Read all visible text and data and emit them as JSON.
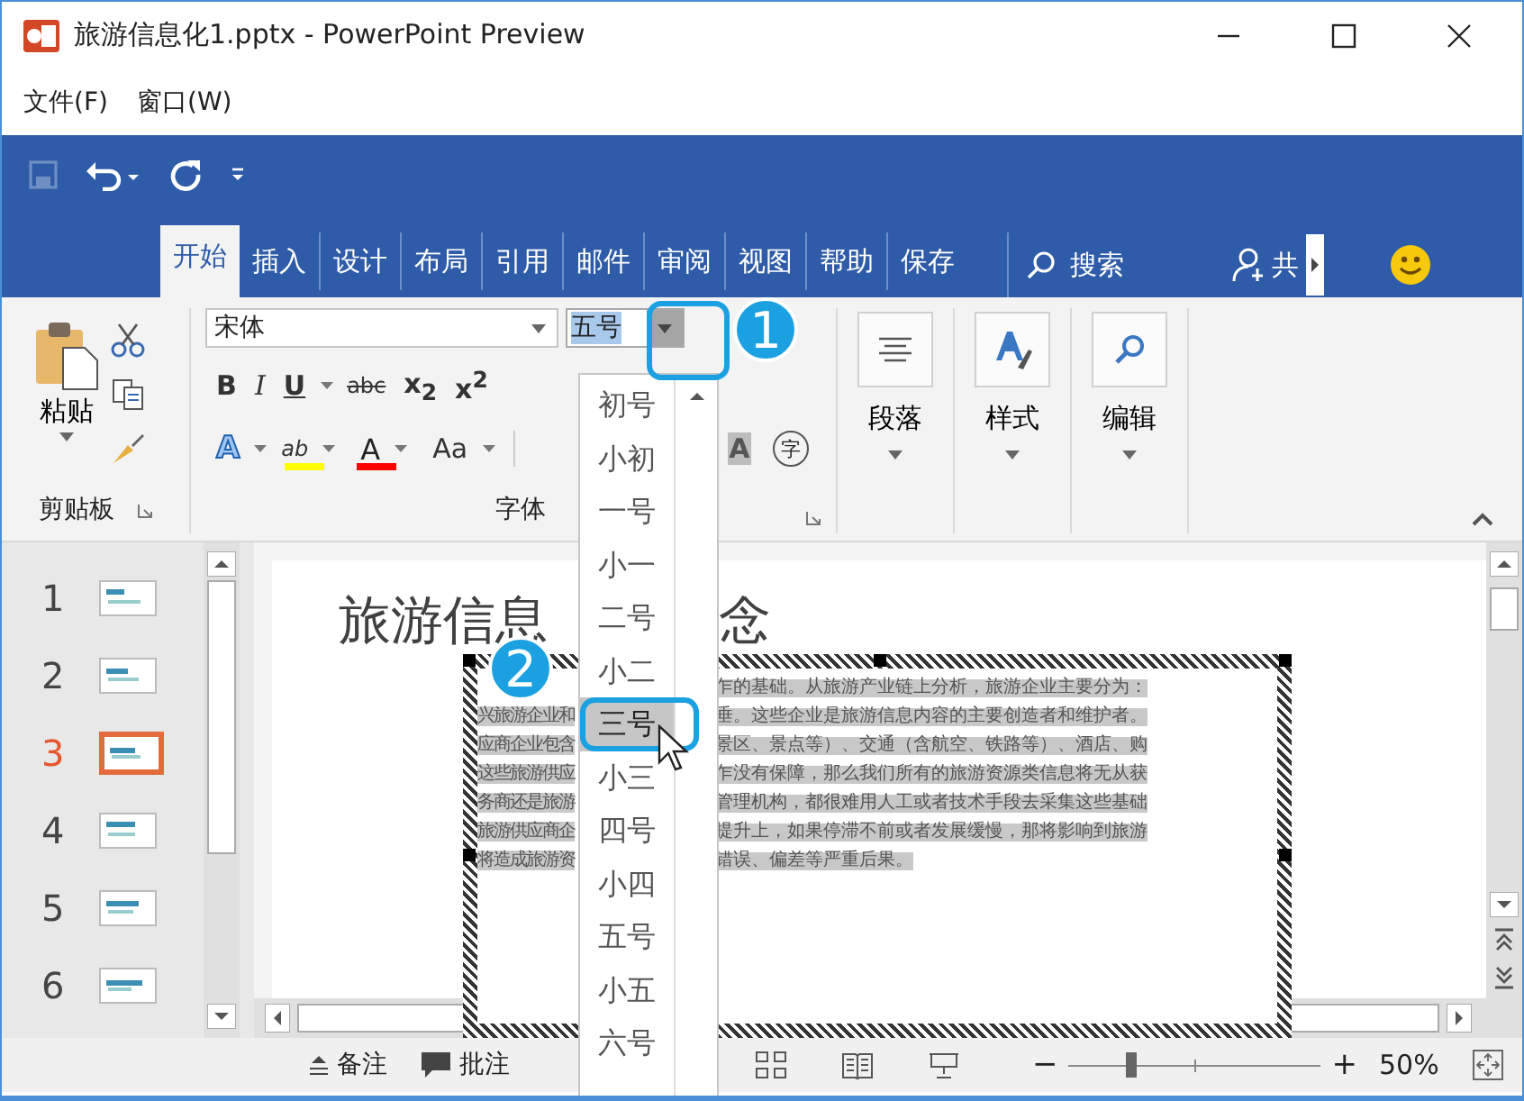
{
  "window": {
    "title": "旅游信息化1.pptx - PowerPoint Preview"
  },
  "menu": [
    "文件(F)",
    "窗口(W)"
  ],
  "quick_access": {
    "save_disabled": true
  },
  "tabs": [
    {
      "label": "开始",
      "selected": true
    },
    {
      "label": "插入",
      "selected": false
    },
    {
      "label": "设计",
      "selected": false
    },
    {
      "label": "布局",
      "selected": false
    },
    {
      "label": "引用",
      "selected": false
    },
    {
      "label": "邮件",
      "selected": false
    },
    {
      "label": "审阅",
      "selected": false
    },
    {
      "label": "视图",
      "selected": false
    },
    {
      "label": "帮助",
      "selected": false
    },
    {
      "label": "保存",
      "selected": false
    }
  ],
  "search": {
    "label": "搜索"
  },
  "share": {
    "label": "共"
  },
  "ribbon": {
    "clipboard": {
      "paste": "粘贴",
      "label": "剪贴板"
    },
    "font": {
      "name": "宋体",
      "size": "五号",
      "label": "字体",
      "row1": [
        {
          "kind": "bold",
          "label": "B"
        },
        {
          "kind": "italic",
          "label": "I"
        },
        {
          "kind": "underline",
          "label": "U"
        },
        {
          "kind": "strike",
          "label": "abc"
        },
        {
          "kind": "sub",
          "label": "x$_{2}$"
        },
        {
          "kind": "sup",
          "label": "x$^{2}$"
        }
      ],
      "row2": [
        {
          "kind": "effects",
          "label": "A"
        },
        {
          "kind": "highlight",
          "label": "ab",
          "color": "#ffff00"
        },
        {
          "kind": "fontcolor",
          "label": "A",
          "color": "#ff0000"
        },
        {
          "kind": "case",
          "label": "Aa"
        }
      ],
      "shading": "A",
      "phonetic": "字"
    },
    "groups": [
      {
        "label": "段落",
        "kind": "paragraph"
      },
      {
        "label": "样式",
        "kind": "styles"
      },
      {
        "label": "编辑",
        "kind": "editing"
      }
    ]
  },
  "size_dropdown": {
    "options": [
      {
        "label": "初号",
        "selected": false
      },
      {
        "label": "小初",
        "selected": false
      },
      {
        "label": "一号",
        "selected": false
      },
      {
        "label": "小一",
        "selected": false
      },
      {
        "label": "二号",
        "selected": false
      },
      {
        "label": "小二",
        "selected": false
      },
      {
        "label": "三号",
        "selected": true
      },
      {
        "label": "小三",
        "selected": false
      },
      {
        "label": "四号",
        "selected": false
      },
      {
        "label": "小四",
        "selected": false
      },
      {
        "label": "五号",
        "selected": false
      },
      {
        "label": "小五",
        "selected": false
      },
      {
        "label": "六号",
        "selected": false
      }
    ]
  },
  "callouts": [
    "1",
    "2"
  ],
  "slides": [
    {
      "number": "1",
      "selected": false
    },
    {
      "number": "2",
      "selected": false
    },
    {
      "number": "3",
      "selected": true
    },
    {
      "number": "4",
      "selected": false
    },
    {
      "number": "5",
      "selected": false
    },
    {
      "number": "6",
      "selected": false
    }
  ],
  "slide": {
    "title_left": "旅游信息",
    "title_right": "念",
    "body": [
      {
        "right": "乍的基础。从旅游产业链上分析，旅游企业主要分为："
      },
      {
        "left": "兴旅游企业和",
        "right": "垂。这些企业是旅游信息内容的主要创造者和维护者。"
      },
      {
        "left": "应商企业包含",
        "right": "景区、景点等）、交通（含航空、铁路等）、酒店、购"
      },
      {
        "left": "这些旅游供应",
        "right": "乍没有保障，那么我们所有的旅游资源类信息将无从获"
      },
      {
        "left": "务商还是旅游",
        "right": "管理机构，都很难用人工或者技术手段去采集这些基础"
      },
      {
        "left": "旅游供应商企",
        "right": "提升上，如果停滞不前或者发展缓慢，那将影响到旅游"
      },
      {
        "left": "将造成旅游资",
        "right": "错误、偏差等严重后果。"
      }
    ]
  },
  "status_bar": {
    "notes": "备注",
    "comments": "批注",
    "zoom_out": "−",
    "zoom_in": "+",
    "zoom": "50%",
    "zoom_slider": {
      "level": 0.23
    }
  }
}
